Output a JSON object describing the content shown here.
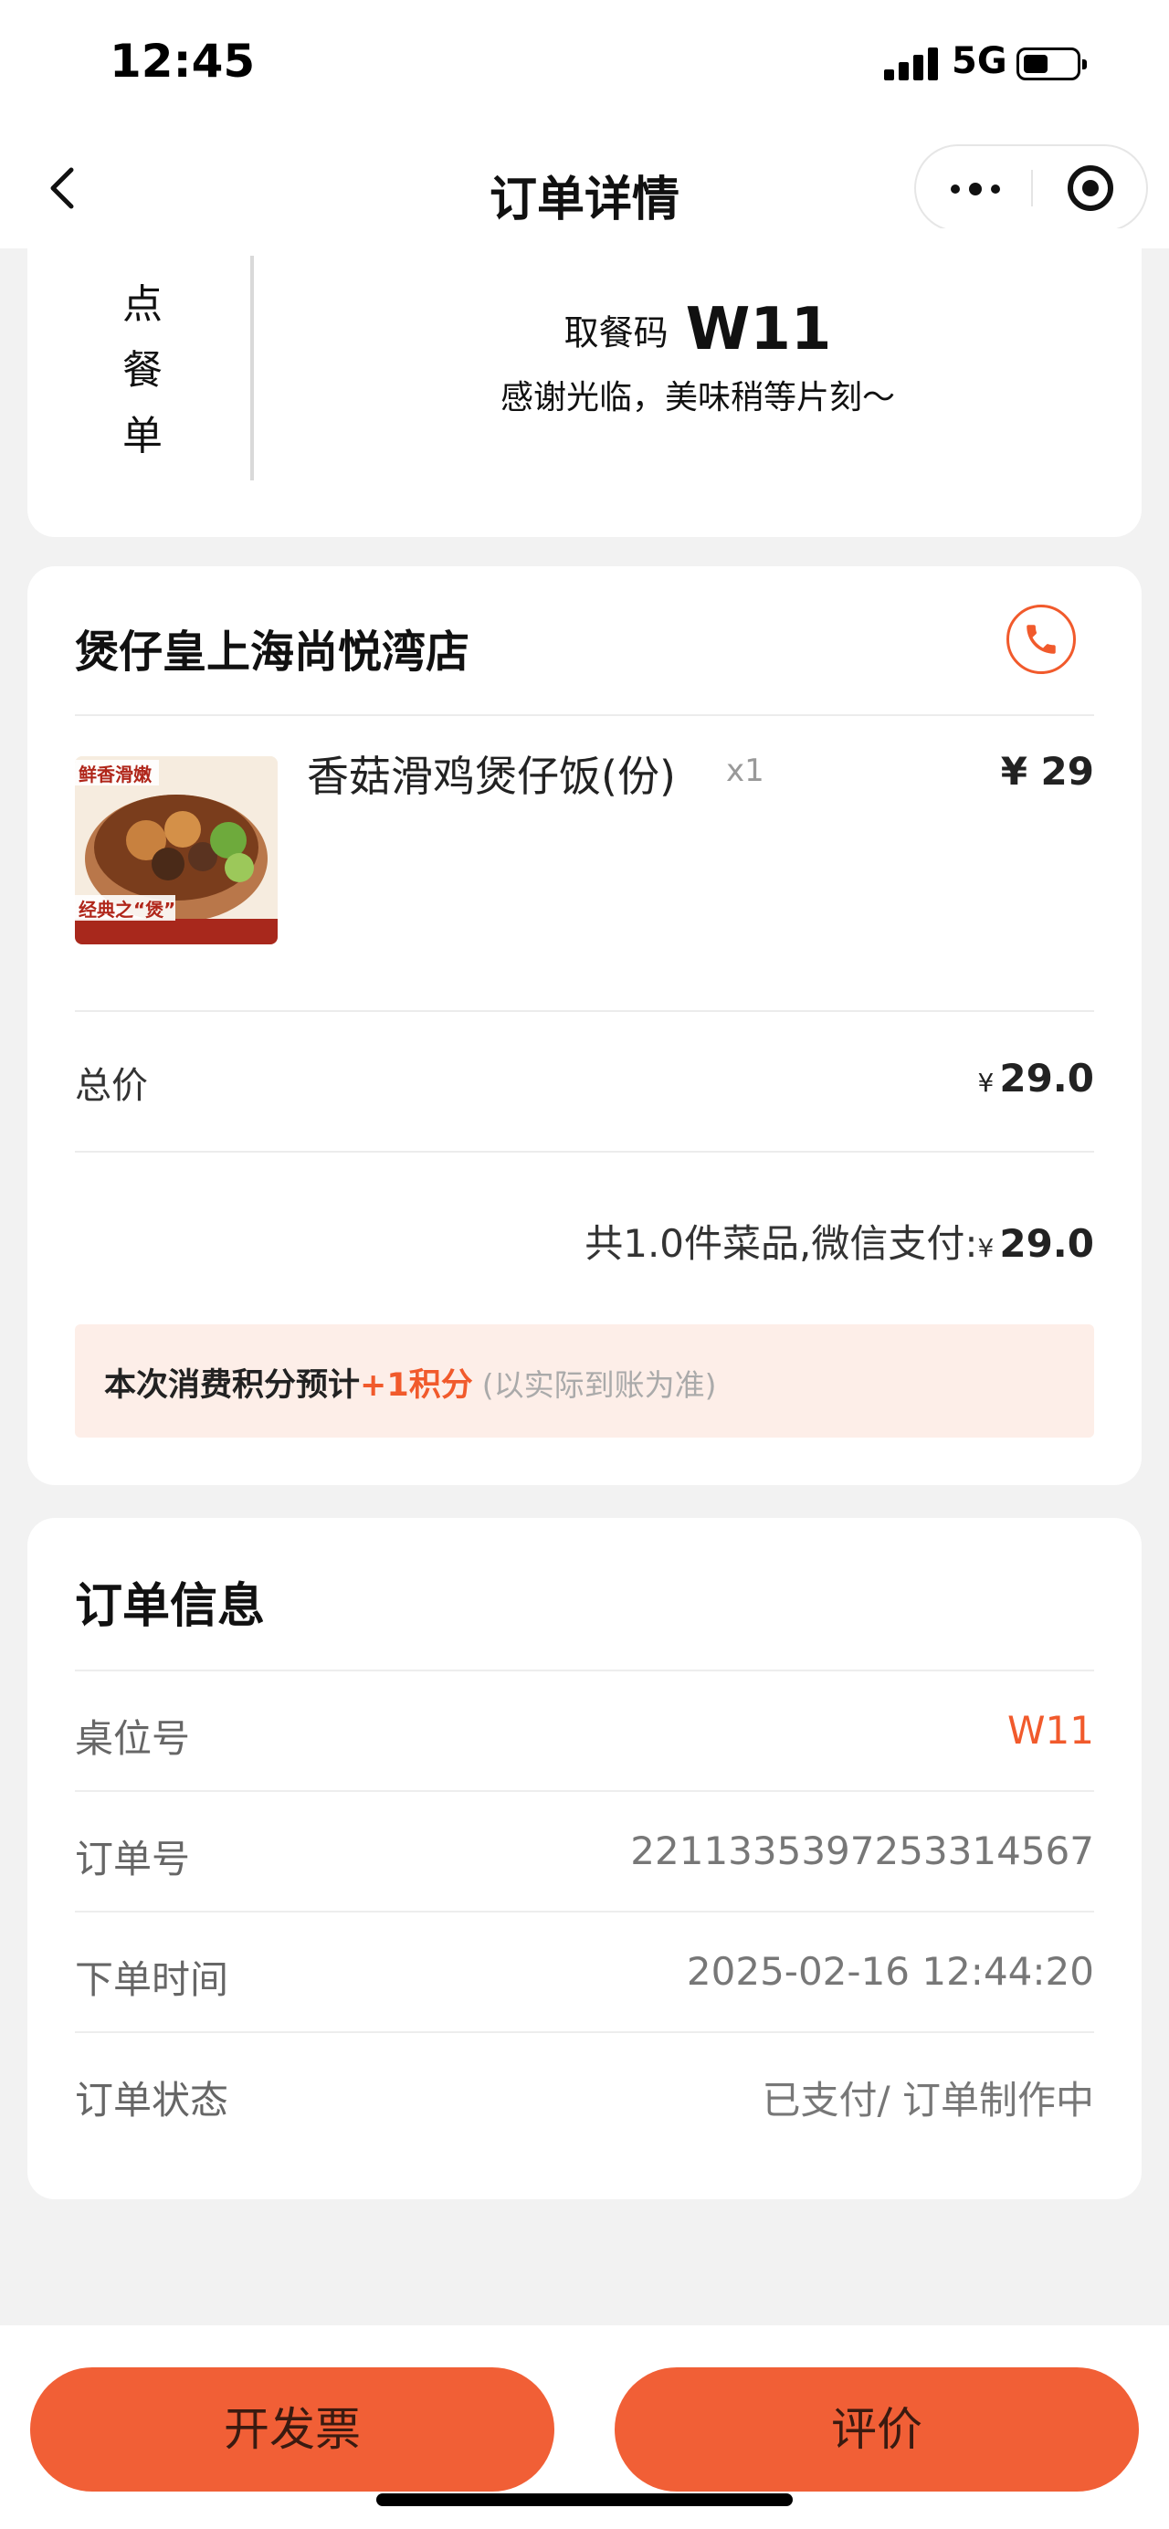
{
  "status_bar": {
    "time": "12:45",
    "network": "5G"
  },
  "nav": {
    "title": "订单详情",
    "icons": [
      "back-icon",
      "more-icon",
      "mini-program-close-icon"
    ]
  },
  "pickup": {
    "vertical_label": [
      "点",
      "餐",
      "单"
    ],
    "code_label": "取餐码",
    "code": "W11",
    "message": "感谢光临，美味稍等片刻～"
  },
  "order": {
    "store_name": "煲仔皇上海尚悦湾店",
    "items": [
      {
        "name": "香菇滑鸡煲仔饭(份)",
        "quantity": "x1",
        "price": "¥ 29",
        "image_text_top": "鲜香滑嫩",
        "image_text_bottom": "经典之“煲”"
      }
    ],
    "total_label": "总价",
    "currency": "¥",
    "total_value": "29.0",
    "summary_prefix": "共1.0件菜品,微信支付:",
    "summary_value": "29.0",
    "points": {
      "prefix": "本次消费积分预计",
      "value": "+1积分",
      "note": "(以实际到账为准)"
    }
  },
  "order_info": {
    "title": "订单信息",
    "rows": [
      {
        "label": "桌位号",
        "value": "W11"
      },
      {
        "label": "订单号",
        "value": "2211335397253314567"
      },
      {
        "label": "下单时间",
        "value": "2025-02-16 12:44:20"
      },
      {
        "label": "订单状态",
        "value": "已支付/ 订单制作中"
      }
    ]
  },
  "actions": {
    "invoice": "开发票",
    "review": "评价"
  },
  "colors": {
    "accent": "#f15a2c",
    "button": "#f15f36",
    "background": "#f2f2f2"
  }
}
